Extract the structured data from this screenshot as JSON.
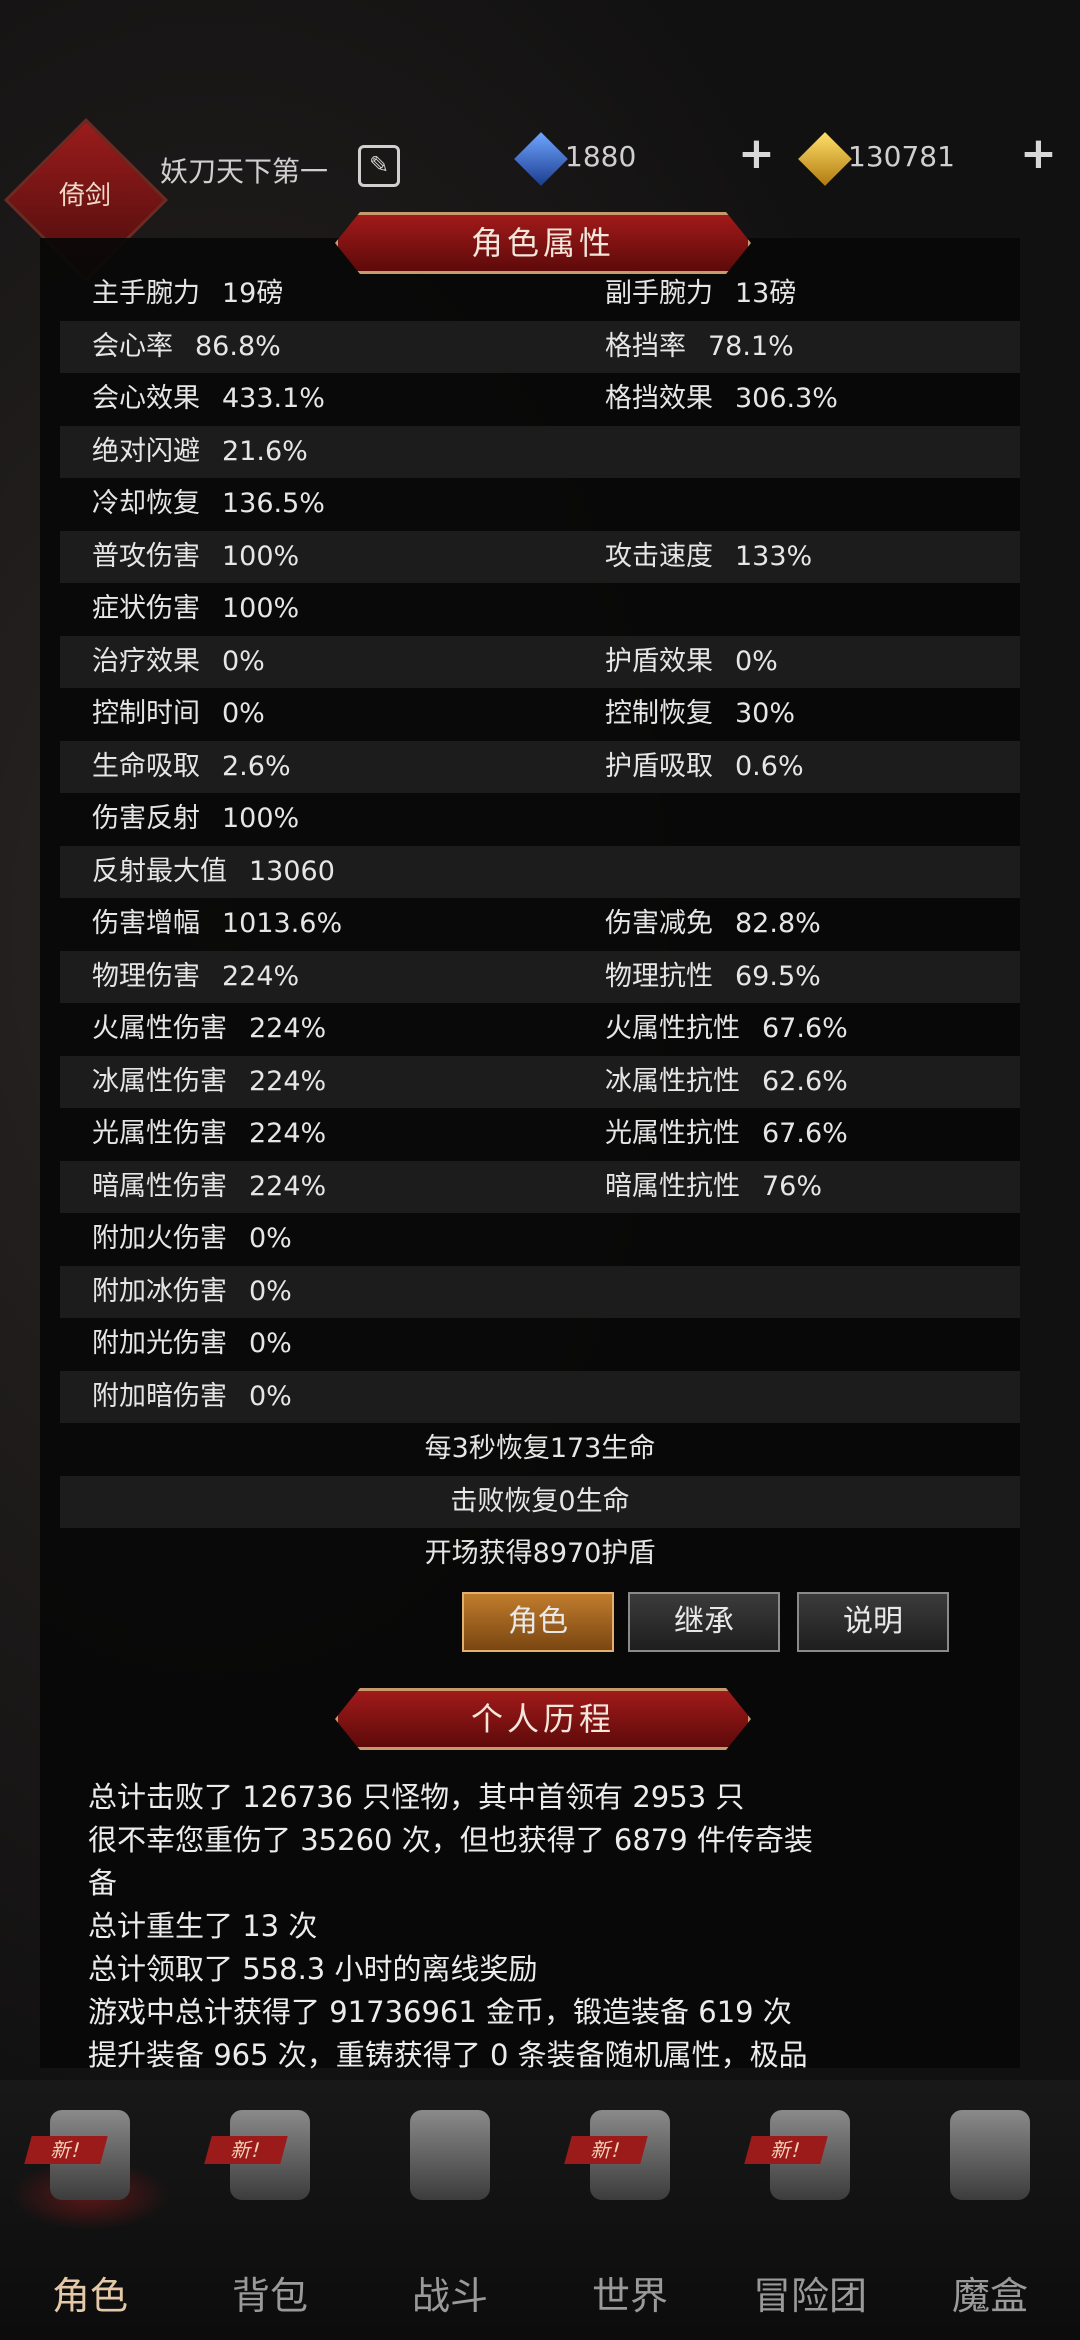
{
  "header": {
    "player_name": "妖刀天下第一",
    "emblem_text": "倚剑",
    "currency_blue": "1880",
    "currency_gold": "130781"
  },
  "attributes": {
    "title": "角色属性",
    "rows": [
      {
        "l_label": "主手腕力",
        "l_value": "19磅",
        "r_label": "副手腕力",
        "r_value": "13磅"
      },
      {
        "l_label": "会心率",
        "l_value": "86.8%",
        "r_label": "格挡率",
        "r_value": "78.1%"
      },
      {
        "l_label": "会心效果",
        "l_value": "433.1%",
        "r_label": "格挡效果",
        "r_value": "306.3%"
      },
      {
        "l_label": "绝对闪避",
        "l_value": "21.6%",
        "r_label": "",
        "r_value": ""
      },
      {
        "l_label": "冷却恢复",
        "l_value": "136.5%",
        "r_label": "",
        "r_value": ""
      },
      {
        "l_label": "普攻伤害",
        "l_value": "100%",
        "r_label": "攻击速度",
        "r_value": "133%"
      },
      {
        "l_label": "症状伤害",
        "l_value": "100%",
        "r_label": "",
        "r_value": ""
      },
      {
        "l_label": "治疗效果",
        "l_value": "0%",
        "r_label": "护盾效果",
        "r_value": "0%"
      },
      {
        "l_label": "控制时间",
        "l_value": "0%",
        "r_label": "控制恢复",
        "r_value": "30%"
      },
      {
        "l_label": "生命吸取",
        "l_value": "2.6%",
        "r_label": "护盾吸取",
        "r_value": "0.6%"
      },
      {
        "l_label": "伤害反射",
        "l_value": "100%",
        "r_label": "",
        "r_value": ""
      },
      {
        "l_label": "反射最大值",
        "l_value": "13060",
        "r_label": "",
        "r_value": ""
      },
      {
        "l_label": "伤害增幅",
        "l_value": "1013.6%",
        "r_label": "伤害减免",
        "r_value": "82.8%"
      },
      {
        "l_label": "物理伤害",
        "l_value": "224%",
        "r_label": "物理抗性",
        "r_value": "69.5%"
      },
      {
        "l_label": "火属性伤害",
        "l_value": "224%",
        "r_label": "火属性抗性",
        "r_value": "67.6%"
      },
      {
        "l_label": "冰属性伤害",
        "l_value": "224%",
        "r_label": "冰属性抗性",
        "r_value": "62.6%"
      },
      {
        "l_label": "光属性伤害",
        "l_value": "224%",
        "r_label": "光属性抗性",
        "r_value": "67.6%"
      },
      {
        "l_label": "暗属性伤害",
        "l_value": "224%",
        "r_label": "暗属性抗性",
        "r_value": "76%"
      },
      {
        "l_label": "附加火伤害",
        "l_value": "0%",
        "r_label": "",
        "r_value": ""
      },
      {
        "l_label": "附加冰伤害",
        "l_value": "0%",
        "r_label": "",
        "r_value": ""
      },
      {
        "l_label": "附加光伤害",
        "l_value": "0%",
        "r_label": "",
        "r_value": ""
      },
      {
        "l_label": "附加暗伤害",
        "l_value": "0%",
        "r_label": "",
        "r_value": ""
      }
    ],
    "center_rows": [
      "每3秒恢复173生命",
      "击败恢复0生命",
      "开场获得8970护盾"
    ]
  },
  "tabs": {
    "character": "角色",
    "inherit": "继承",
    "explain": "说明"
  },
  "history": {
    "title": "个人历程",
    "lines": [
      "总计击败了 126736 只怪物，其中首领有 2953 只",
      "很不幸您重伤了 35260 次，但也获得了 6879 件传奇装",
      "备",
      "总计重生了 13 次",
      "总计领取了 558.3 小时的离线奖励",
      "游戏中总计获得了 91736961 金币，锻造装备 619 次",
      "提升装备 965 次，重铸获得了 0 条装备随机属性，极品"
    ]
  },
  "nav": {
    "badge": "新!",
    "items": [
      "角色",
      "背包",
      "战斗",
      "世界",
      "冒险团",
      "魔盒"
    ]
  },
  "colors": {
    "accent_red": "#9b1a1a",
    "gold": "#c07c2c"
  }
}
